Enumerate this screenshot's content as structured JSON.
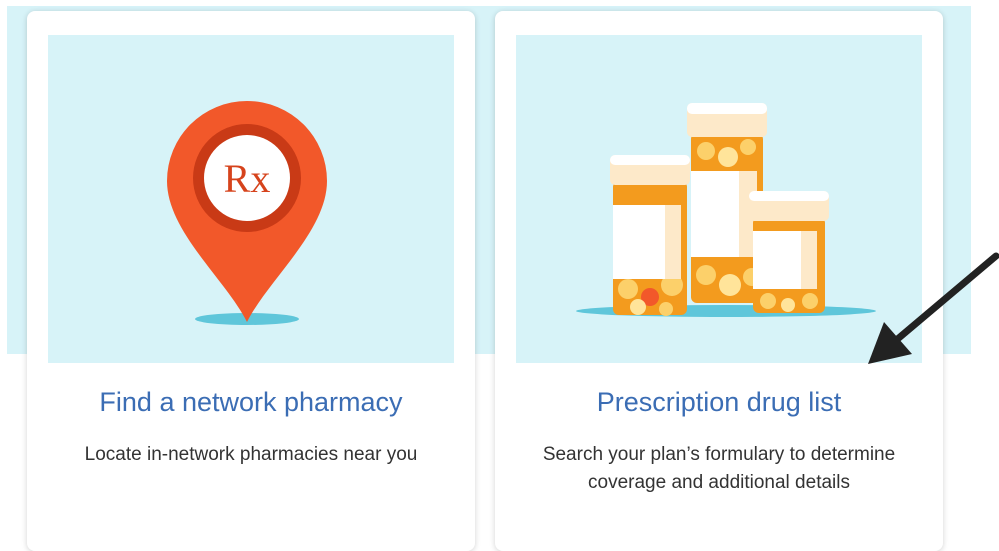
{
  "cards": [
    {
      "title": "Find a network pharmacy",
      "description": "Locate in-network pharmacies near you",
      "icon": "rx-map-pin-icon"
    },
    {
      "title": "Prescription drug list",
      "description": "Search your plan’s formulary to determine coverage and additional details",
      "icon": "pill-bottles-icon"
    }
  ],
  "pin_label": "Rx",
  "colors": {
    "accent_blue": "#3b6db4",
    "tile_background": "#d7f3f8",
    "pin_orange": "#f2582a",
    "bottle_orange": "#f39b1e",
    "annotation_arrow": "#222222"
  }
}
